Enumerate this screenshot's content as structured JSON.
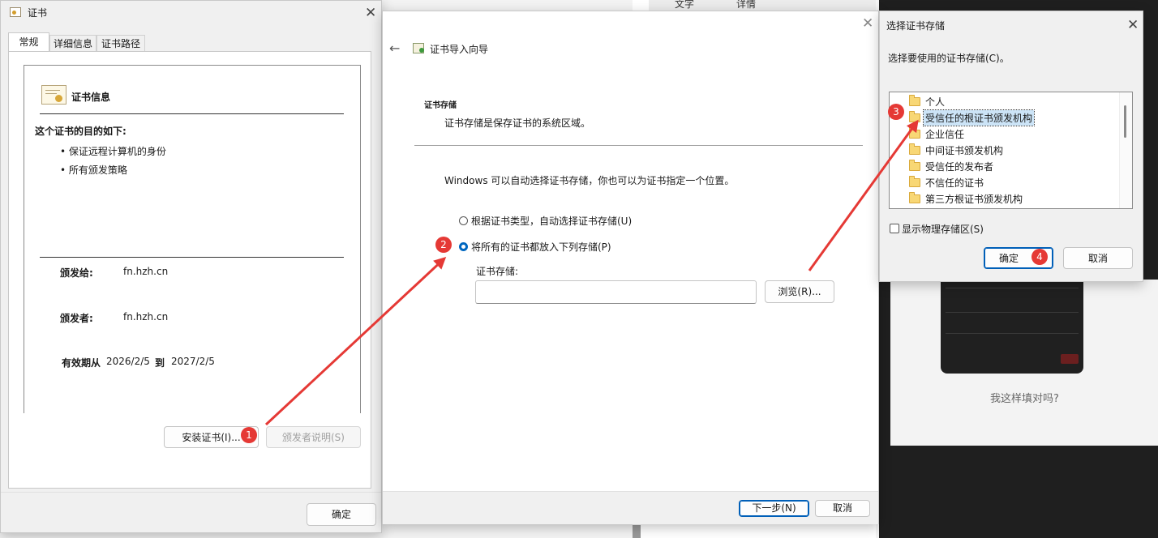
{
  "background": {
    "right_panel_text": "我这样填对吗?",
    "tab1": "文字",
    "tab2": "详情"
  },
  "cert_window": {
    "title": "证书",
    "tabs": [
      "常规",
      "详细信息",
      "证书路径"
    ],
    "info_title": "证书信息",
    "purpose_heading": "这个证书的目的如下:",
    "purposes": [
      "• 保证远程计算机的身份",
      "• 所有颁发策略"
    ],
    "issued_to_label": "颁发给:",
    "issued_to_value": "fn.hzh.cn",
    "issued_by_label": "颁发者:",
    "issued_by_value": "fn.hzh.cn",
    "validity_label": "有效期从",
    "valid_from": "2026/2/5",
    "to_label": "到",
    "valid_to": "2027/2/5",
    "install_button": "安装证书(I)...",
    "issuer_statement_button": "颁发者说明(S)",
    "ok_button": "确定"
  },
  "wizard": {
    "title": "证书导入向导",
    "section_title": "证书存储",
    "section_desc": "证书存储是保存证书的系统区域。",
    "body_text": "Windows 可以自动选择证书存储，你也可以为证书指定一个位置。",
    "option_auto": "根据证书类型，自动选择证书存储(U)",
    "option_manual": "将所有的证书都放入下列存储(P)",
    "store_label": "证书存储:",
    "store_value": "",
    "browse_button": "浏览(R)...",
    "next_button": "下一步(N)",
    "cancel_button": "取消"
  },
  "store_dialog": {
    "title": "选择证书存储",
    "prompt": "选择要使用的证书存储(C)。",
    "items": [
      "个人",
      "受信任的根证书颁发机构",
      "企业信任",
      "中间证书颁发机构",
      "受信任的发布者",
      "不信任的证书",
      "第三方根证书颁发机构"
    ],
    "selected_index": 1,
    "show_physical": "显示物理存储区(S)",
    "ok_button": "确定",
    "cancel_button": "取消"
  },
  "annotations": [
    "1",
    "2",
    "3",
    "4"
  ],
  "colors": {
    "arrow": "#e53935",
    "accent": "#0067c0",
    "selection": "#cce4f7"
  }
}
